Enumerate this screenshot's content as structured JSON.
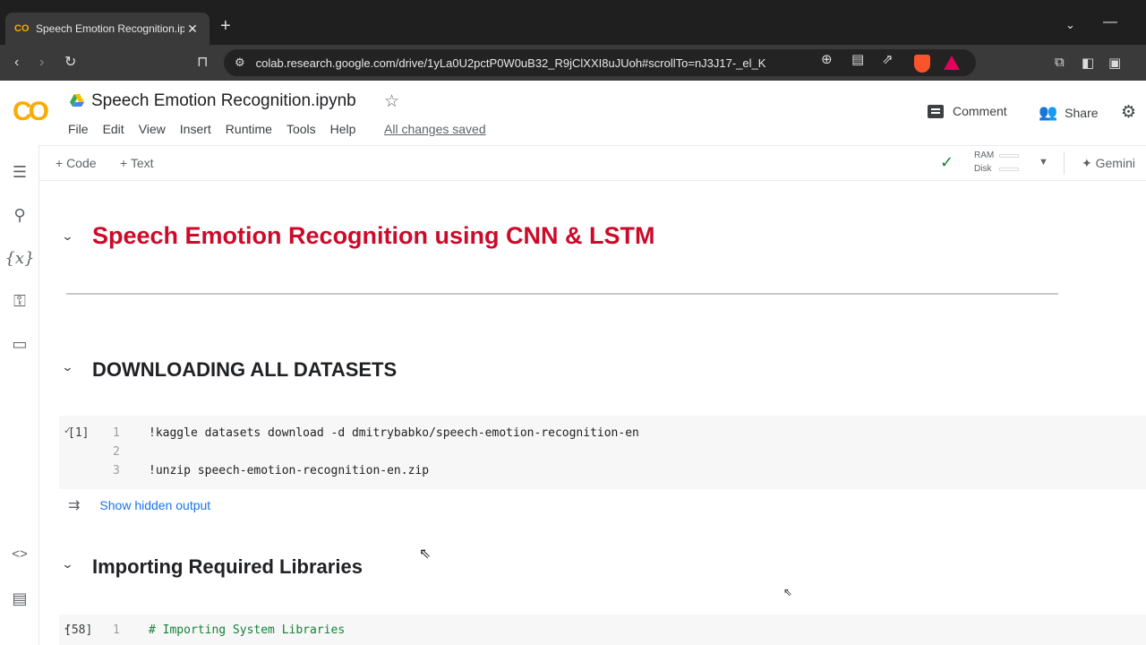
{
  "browser": {
    "tab_title": "Speech Emotion Recognition.ip",
    "tab_favicon": "CO",
    "new_tab": "+",
    "url": "colab.research.google.com/drive/1yLa0U2pctP0W0uB32_R9jClXXI8uJUoh#scrollTo=nJ3J17-_el_K"
  },
  "header": {
    "logo_text": "CO",
    "title": "Speech Emotion Recognition.ipynb",
    "menu": [
      "File",
      "Edit",
      "View",
      "Insert",
      "Runtime",
      "Tools",
      "Help"
    ],
    "saved_status": "All changes saved",
    "comment_label": "Comment",
    "share_label": "Share"
  },
  "toolbar": {
    "add_code": "+ Code",
    "add_text": "+ Text",
    "ram_label": "RAM",
    "disk_label": "Disk",
    "gemini_label": "Gemini"
  },
  "notebook": {
    "main_heading": "Speech Emotion Recognition using CNN & LSTM",
    "section1_heading": "DOWNLOADING ALL DATASETS",
    "cell1": {
      "exec_count": "[1]",
      "lines": [
        {
          "num": "1",
          "code": "!kaggle datasets download -d dmitrybabko/speech-emotion-recognition-en"
        },
        {
          "num": "2",
          "code": ""
        },
        {
          "num": "3",
          "code": "!unzip speech-emotion-recognition-en.zip"
        }
      ]
    },
    "show_hidden_output": "Show hidden output",
    "section2_heading": "Importing Required Libraries",
    "cell2": {
      "exec_count": "[58]",
      "lines": [
        {
          "num": "1",
          "code": "# Importing System Libraries"
        }
      ]
    }
  },
  "colors": {
    "heading_red": "#cc0a2a",
    "link_blue": "#1a73e8",
    "colab_orange": "#f9ab00"
  }
}
